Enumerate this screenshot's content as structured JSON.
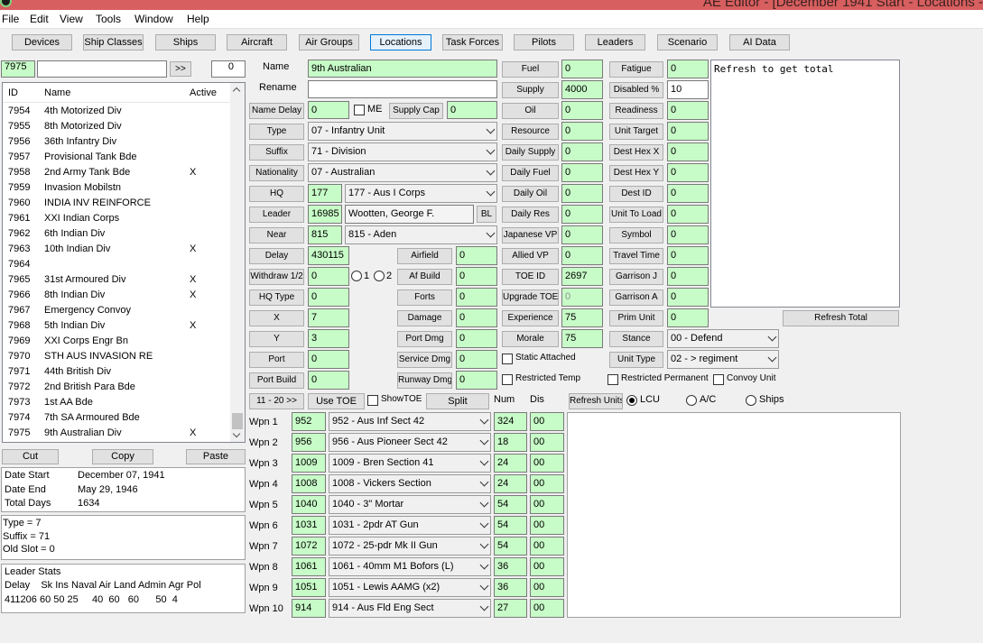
{
  "window": {
    "title": "AE Editor - [December 1941 Start - Locations -"
  },
  "menu": [
    "File",
    "Edit",
    "View",
    "Tools",
    "Window",
    "Help"
  ],
  "tabs": [
    "Devices",
    "Ship Classes",
    "Ships",
    "Aircraft",
    "Air Groups",
    "Locations",
    "Task Forces",
    "Pilots",
    "Leaders",
    "Scenario",
    "AI Data"
  ],
  "search": {
    "id": "7975",
    "text": "",
    "go": ">>",
    "count": "0"
  },
  "list": {
    "headers": [
      "ID",
      "Name",
      "Active"
    ],
    "rows": [
      [
        "7954",
        "4th Motorized Div",
        ""
      ],
      [
        "7955",
        "8th Motorized Div",
        ""
      ],
      [
        "7956",
        "36th Infantry Div",
        ""
      ],
      [
        "7957",
        "Provisional Tank Bde",
        ""
      ],
      [
        "7958",
        "2nd Army Tank Bde",
        "X"
      ],
      [
        "7959",
        "Invasion Mobilstn",
        ""
      ],
      [
        "7960",
        "INDIA INV REINFORCE",
        ""
      ],
      [
        "7961",
        "XXI Indian Corps",
        ""
      ],
      [
        "7962",
        "6th Indian Div",
        ""
      ],
      [
        "7963",
        "10th Indian Div",
        "X"
      ],
      [
        "7964",
        "",
        ""
      ],
      [
        "7965",
        "31st Armoured Div",
        "X"
      ],
      [
        "7966",
        "8th Indian Div",
        "X"
      ],
      [
        "7967",
        "Emergency Convoy",
        ""
      ],
      [
        "7968",
        "5th Indian Div",
        "X"
      ],
      [
        "7969",
        "XXI Corps Engr Bn",
        ""
      ],
      [
        "7970",
        "STH AUS INVASION RE",
        ""
      ],
      [
        "7971",
        "44th British Div",
        ""
      ],
      [
        "7972",
        "2nd British Para Bde",
        ""
      ],
      [
        "7973",
        "1st AA Bde",
        ""
      ],
      [
        "7974",
        "7th SA Armoured Bde",
        ""
      ],
      [
        "7975",
        "9th Australian Div",
        "X"
      ]
    ]
  },
  "clipboard": {
    "cut": "Cut",
    "copy": "Copy",
    "paste": "Paste"
  },
  "dates": {
    "start_label": "Date Start",
    "start": "December 07, 1941",
    "end_label": "Date End",
    "end": "May 29, 1946",
    "total_label": "Total Days",
    "total": "1634"
  },
  "info": {
    "type": "Type = 7",
    "suffix": "Suffix = 71",
    "old_slot": "Old Slot = 0"
  },
  "leader_stats": {
    "title": "Leader Stats",
    "headers": "Delay    Sk Ins Naval Air Land Admin Agr Pol",
    "values": "411206 60 50 25     40  60   60      50  4"
  },
  "form": {
    "name_label": "Name",
    "name": "9th Australian",
    "rename_label": "Rename",
    "rename": "",
    "name_delay_label": "Name Delay",
    "name_delay": "0",
    "me_label": "ME",
    "supply_cap_label": "Supply Cap",
    "supply_cap": "0",
    "type_label": "Type",
    "type": "07 - Infantry Unit",
    "suffix_label": "Suffix",
    "suffix": "71 - Division",
    "nationality_label": "Nationality",
    "nationality": "07 - Australian",
    "hq_label": "HQ",
    "hq": "177",
    "hq_combo": "177 - Aus I Corps",
    "leader_label": "Leader",
    "leader": "16985",
    "leader_name": "Wootten, George F.",
    "bl": "BL",
    "near_label": "Near",
    "near": "815",
    "near_combo": "815 - Aden",
    "delay_label": "Delay",
    "delay": "430115",
    "withdraw_label": "Withdraw 1/2",
    "withdraw": "0",
    "r1": "1",
    "r2": "2",
    "hq_type_label": "HQ Type",
    "hq_type": "0",
    "x_label": "X",
    "x": "7",
    "y_label": "Y",
    "y": "3",
    "port_label": "Port",
    "port": "0",
    "port_build_label": "Port Build",
    "port_build": "0",
    "airfield_label": "Airfield",
    "airfield": "0",
    "af_build_label": "Af Build",
    "af_build": "0",
    "forts_label": "Forts",
    "forts": "0",
    "damage_label": "Damage",
    "damage": "0",
    "port_dmg_label": "Port Dmg",
    "port_dmg": "0",
    "service_dmg_label": "Service Dmg",
    "service_dmg": "0",
    "runway_dmg_label": "Runway Dmg",
    "runway_dmg": "0",
    "fuel_label": "Fuel",
    "fuel": "0",
    "supply_label": "Supply",
    "supply": "4000",
    "oil_label": "Oil",
    "oil": "0",
    "resource_label": "Resource",
    "resource": "0",
    "daily_supply_label": "Daily Supply",
    "daily_supply": "0",
    "daily_fuel_label": "Daily Fuel",
    "daily_fuel": "0",
    "daily_oil_label": "Daily Oil",
    "daily_oil": "0",
    "daily_res_label": "Daily Res",
    "daily_res": "0",
    "japanese_vp_label": "Japanese VP",
    "japanese_vp": "0",
    "allied_vp_label": "Allied VP",
    "allied_vp": "0",
    "toe_id_label": "TOE ID",
    "toe_id": "2697",
    "upgrade_toe_label": "Upgrade TOE",
    "upgrade_toe": "0",
    "experience_label": "Experience",
    "experience": "75",
    "morale_label": "Morale",
    "morale": "75",
    "fatigue_label": "Fatigue",
    "fatigue": "0",
    "disabled_label": "Disabled %",
    "disabled": "10",
    "readiness_label": "Readiness",
    "readiness": "0",
    "unit_target_label": "Unit Target",
    "unit_target": "0",
    "dest_hex_x_label": "Dest Hex X",
    "dest_hex_x": "0",
    "dest_hex_y_label": "Dest Hex Y",
    "dest_hex_y": "0",
    "dest_id_label": "Dest ID",
    "dest_id": "0",
    "unit_to_load_label": "Unit To Load",
    "unit_to_load": "0",
    "symbol_label": "Symbol",
    "symbol": "0",
    "travel_time_label": "Travel Time",
    "travel_time": "0",
    "garrison_j_label": "Garrison J",
    "garrison_j": "0",
    "garrison_a_label": "Garrison A",
    "garrison_a": "0",
    "prim_unit_label": "Prim Unit",
    "prim_unit": "0",
    "stance_label": "Stance",
    "stance": "00 - Defend",
    "unit_type_label": "Unit Type",
    "unit_type": "02 - > regiment",
    "static_attached_label": "Static Attached",
    "restricted_temp_label": "Restricted Temp",
    "restricted_permanent_label": "Restricted Permanent",
    "convoy_unit_label": "Convoy Unit",
    "memo": "Refresh to get total",
    "refresh_total": "Refresh Total"
  },
  "weapons_bar": {
    "page_btn": "11 - 20  >>",
    "use_toe": "Use TOE",
    "show_toe": "ShowTOE",
    "split": "Split",
    "num_label": "Num",
    "dis_label": "Dis",
    "refresh_units": "Refresh Units",
    "lcu": "LCU",
    "ac": "A/C",
    "ships": "Ships"
  },
  "weapons": [
    {
      "label": "Wpn 1",
      "id": "952",
      "name": "952 - Aus Inf Sect 42",
      "num": "324",
      "dis": "00"
    },
    {
      "label": "Wpn 2",
      "id": "956",
      "name": "956 - Aus Pioneer Sect 42",
      "num": "18",
      "dis": "00"
    },
    {
      "label": "Wpn 3",
      "id": "1009",
      "name": "1009 - Bren Section 41",
      "num": "24",
      "dis": "00"
    },
    {
      "label": "Wpn 4",
      "id": "1008",
      "name": "1008 - Vickers Section",
      "num": "24",
      "dis": "00"
    },
    {
      "label": "Wpn 5",
      "id": "1040",
      "name": "1040 - 3\" Mortar",
      "num": "54",
      "dis": "00"
    },
    {
      "label": "Wpn 6",
      "id": "1031",
      "name": "1031 - 2pdr AT Gun",
      "num": "54",
      "dis": "00"
    },
    {
      "label": "Wpn 7",
      "id": "1072",
      "name": "1072 - 25-pdr Mk II Gun",
      "num": "54",
      "dis": "00"
    },
    {
      "label": "Wpn 8",
      "id": "1061",
      "name": "1061 - 40mm M1 Bofors (L)",
      "num": "36",
      "dis": "00"
    },
    {
      "label": "Wpn 9",
      "id": "1051",
      "name": "1051 - Lewis AAMG (x2)",
      "num": "36",
      "dis": "00"
    },
    {
      "label": "Wpn 10",
      "id": "914",
      "name": "914 - Aus Fld Eng Sect",
      "num": "27",
      "dis": "00"
    }
  ]
}
